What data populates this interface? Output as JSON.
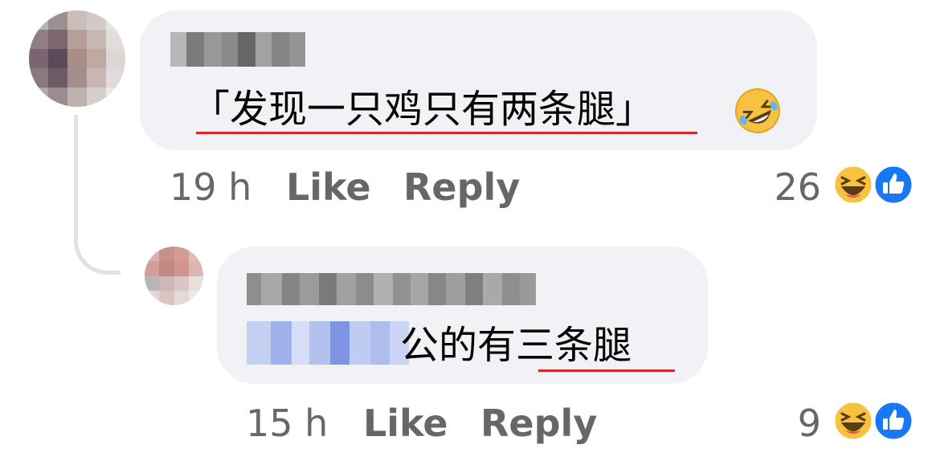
{
  "comments": [
    {
      "text": "「发现一只鸡只有两条腿」",
      "emoji": "rolling-on-floor-laughing-emoji",
      "time": "19 h",
      "like_label": "Like",
      "reply_label": "Reply",
      "reaction_count": "26",
      "reactions": [
        "haha-icon",
        "like-icon"
      ]
    },
    {
      "text": "公的有三条腿",
      "time": "15 h",
      "like_label": "Like",
      "reply_label": "Reply",
      "reaction_count": "9",
      "reactions": [
        "haha-icon",
        "like-icon"
      ]
    }
  ],
  "colors": {
    "bubble": "#f0f2f5",
    "meta_text": "#65676b",
    "underline": "#d9252c",
    "like_blue": "#1877f2",
    "haha_yellow": "#f7c23f"
  }
}
